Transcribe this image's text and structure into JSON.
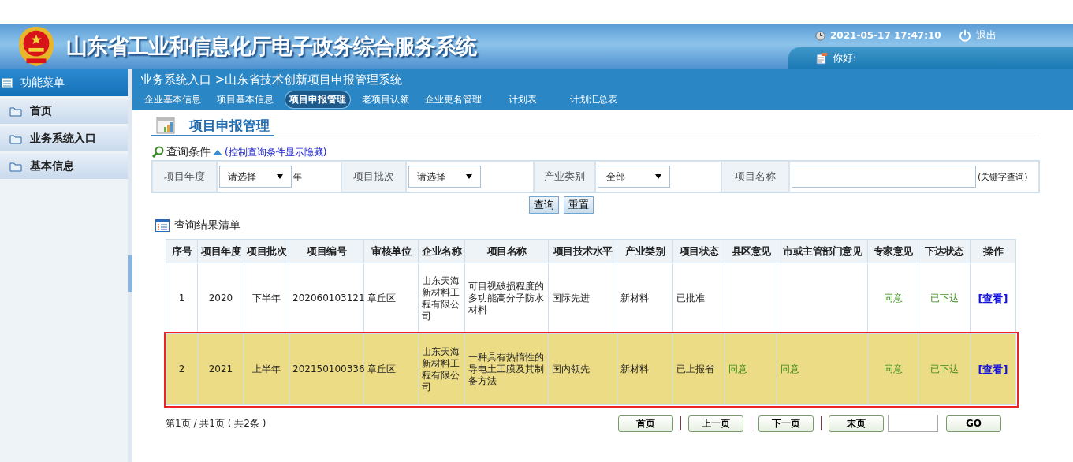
{
  "header": {
    "title": "山东省工业和信息化厅电子政务综合服务系统",
    "datetime": "2021-05-17 17:47:10",
    "logout": "退出",
    "greeting": "你好:"
  },
  "sidebar": {
    "title": "功能菜单",
    "items": [
      {
        "label": "首页",
        "selected": false
      },
      {
        "label": "业务系统入口",
        "selected": false
      },
      {
        "label": "基本信息",
        "selected": false
      }
    ]
  },
  "breadcrumb": "业务系统入口 >山东省技术创新项目申报管理系统",
  "tabs": [
    {
      "label": "企业基本信息",
      "selected": false
    },
    {
      "label": "项目基本信息",
      "selected": false
    },
    {
      "label": "项目申报管理",
      "selected": true
    },
    {
      "label": "老项目认领",
      "selected": false
    },
    {
      "label": "企业更名管理",
      "selected": false
    },
    {
      "label": "计划表",
      "selected": false
    },
    {
      "label": "计划汇总表",
      "selected": false
    }
  ],
  "page_title": "项目申报管理",
  "query": {
    "title": "查询条件",
    "toggle": "(控制查询条件显示隐藏)",
    "filters": [
      {
        "kind": "select",
        "label": "项目年度",
        "value": "请选择",
        "suffix": "年"
      },
      {
        "kind": "select",
        "label": "项目批次",
        "value": "请选择"
      },
      {
        "kind": "select",
        "label": "产业类别",
        "value": "全部"
      },
      {
        "kind": "text",
        "label": "项目名称",
        "suffix": "(关键字查询)"
      }
    ],
    "buttons": [
      "查询",
      "重置"
    ]
  },
  "results": {
    "title": "查询结果清单",
    "columns": [
      {
        "label": "序号",
        "kind": "center"
      },
      {
        "label": "项目年度",
        "kind": "center"
      },
      {
        "label": "项目批次",
        "kind": "center"
      },
      {
        "label": "项目编号",
        "kind": "text"
      },
      {
        "label": "审核单位",
        "kind": "text"
      },
      {
        "label": "企业名称",
        "kind": "text"
      },
      {
        "label": "项目名称",
        "kind": "text"
      },
      {
        "label": "项目技术水平",
        "kind": "text"
      },
      {
        "label": "产业类别",
        "kind": "text"
      },
      {
        "label": "项目状态",
        "kind": "text"
      },
      {
        "label": "县区意见",
        "kind": "opinion"
      },
      {
        "label": "市或主管部门意见",
        "kind": "opinion"
      },
      {
        "label": "专家意见",
        "kind": "opinion-center"
      },
      {
        "label": "下达状态",
        "kind": "opinion-center"
      },
      {
        "label": "操作",
        "kind": "link"
      }
    ],
    "rows": [
      {
        "selected": false,
        "cells": [
          "1",
          "2020",
          "下半年",
          "202060103121",
          "章丘区",
          "山东天海新材料工程有限公司",
          "可目视破损程度的多功能高分子防水材料",
          "国际先进",
          "新材料",
          "已批准",
          "",
          "",
          "同意",
          "已下达",
          "[查看]"
        ]
      },
      {
        "selected": true,
        "cells": [
          "2",
          "2021",
          "上半年",
          "202150100336",
          "章丘区",
          "山东天海新材料工程有限公司",
          "一种具有热惰性的导电土工膜及其制备方法",
          "国内领先",
          "新材料",
          "已上报省",
          "同意",
          "同意",
          "同意",
          "已下达",
          "[查看]"
        ]
      }
    ]
  },
  "pagination": {
    "info": "第1页 / 共1页 ( 共2条 )",
    "buttons": [
      "首页",
      "上一页",
      "下一页",
      "末页"
    ],
    "go": "GO"
  }
}
